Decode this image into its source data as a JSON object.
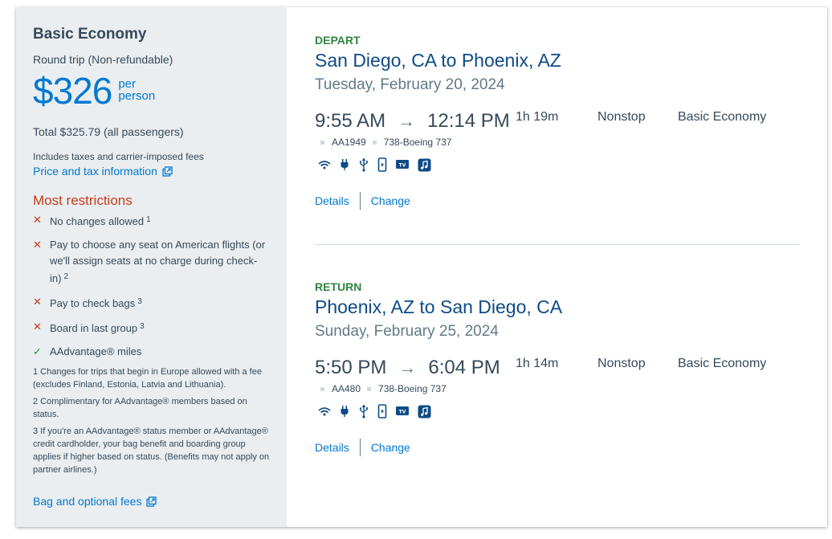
{
  "fare": {
    "name": "Basic Economy",
    "trip_type": "Round trip (Non-refundable)",
    "price": "$326",
    "per_person": "per person",
    "per_line1": "per",
    "per_line2": "person",
    "total": "Total $325.79 (all passengers)",
    "taxes_note": "Includes taxes and carrier-imposed fees",
    "price_tax_link": "Price and tax information"
  },
  "restrictions": {
    "title": "Most restrictions",
    "items": [
      {
        "text": "No changes allowed",
        "note": "1",
        "type": "x"
      },
      {
        "text": "Pay to choose any seat on American flights (or we'll assign seats at no charge during check-in)",
        "note": "2",
        "type": "x"
      },
      {
        "text": "Pay to check bags",
        "note": "3",
        "type": "x"
      },
      {
        "text": "Board in last group",
        "note": "3",
        "type": "x"
      },
      {
        "text": "AAdvantage® miles",
        "note": "",
        "type": "ok"
      }
    ],
    "footnotes": [
      "1 Changes for trips that begin in Europe allowed with a fee (excludes Finland, Estonia, Latvia and Lithuania).",
      "2 Complimentary for AAdvantage® members based on status.",
      "3 If you're an AAdvantage® status member or AAdvantage® credit cardholder, your bag benefit and boarding group applies if higher based on status. (Benefits may not apply on partner airlines.)"
    ],
    "bag_link": "Bag and optional fees"
  },
  "legs": {
    "depart": {
      "label": "DEPART",
      "route": "San Diego, CA to Phoenix, AZ",
      "date": "Tuesday, February 20, 2024",
      "dep_time": "9:55 AM",
      "arr_time": "12:14 PM",
      "duration": "1h 19m",
      "stops": "Nonstop",
      "cabin": "Basic Economy",
      "flight": "AA1949",
      "aircraft": "738-Boeing 737",
      "details": "Details",
      "change": "Change"
    },
    "return": {
      "label": "RETURN",
      "route": "Phoenix, AZ to San Diego, CA",
      "date": "Sunday, February 25, 2024",
      "dep_time": "5:50 PM",
      "arr_time": "6:04 PM",
      "duration": "1h 14m",
      "stops": "Nonstop",
      "cabin": "Basic Economy",
      "flight": "AA480",
      "aircraft": "738-Boeing 737",
      "details": "Details",
      "change": "Change"
    }
  },
  "amenity_icons": [
    "wifi-icon",
    "power-outlet-icon",
    "usb-icon",
    "phone-entertainment-icon",
    "tv-icon",
    "music-icon"
  ],
  "colors": {
    "accent_blue": "#0078d2",
    "restriction_red": "#c53b17",
    "leg_green": "#2e8540",
    "route_navy": "#0e4b86"
  }
}
